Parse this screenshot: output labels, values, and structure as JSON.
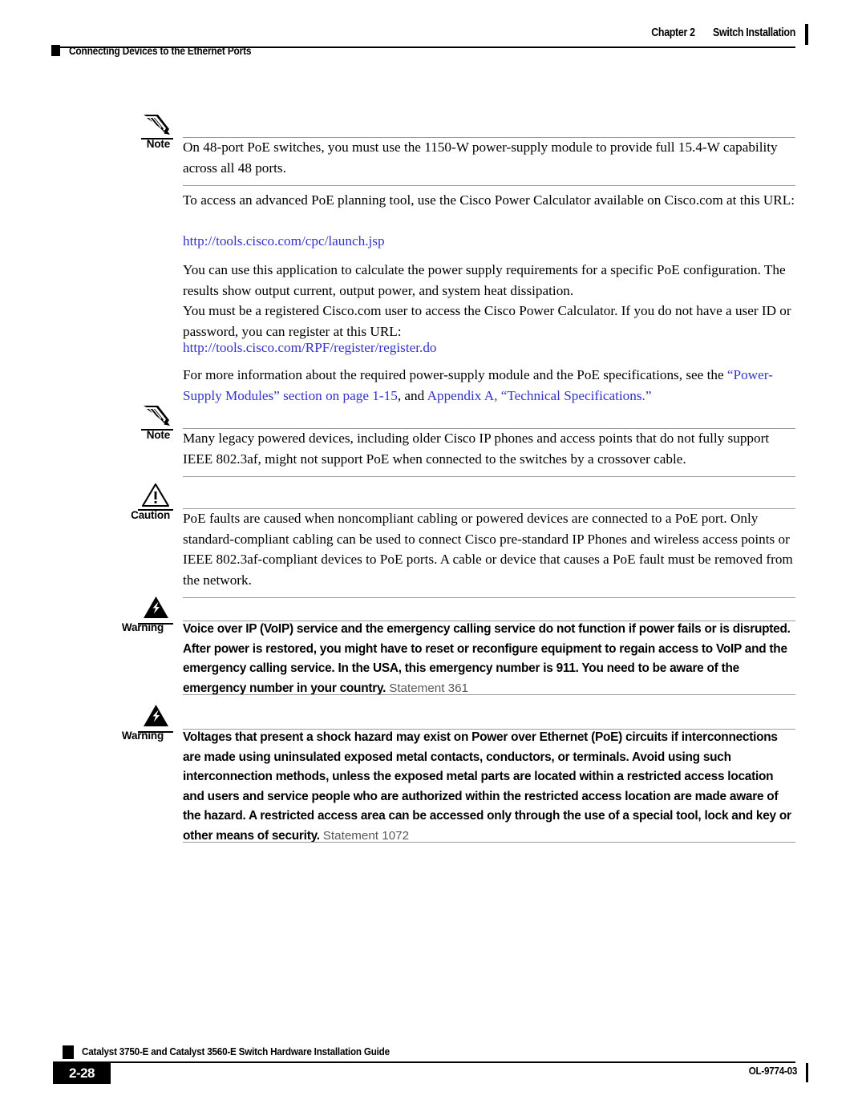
{
  "header": {
    "chapter_number": "Chapter 2",
    "chapter_title": "Switch Installation",
    "section_title": "Connecting Devices to the Ethernet Ports"
  },
  "content": {
    "note_1": {
      "label": "Note",
      "icon": "pencil-icon",
      "text": "On 48-port PoE switches, you must use the 1150-W power-supply module to provide full 15.4-W capability across all 48 ports."
    },
    "para_1": "To access an advanced PoE planning tool, use the Cisco Power Calculator available on Cisco.com at this URL:",
    "link_1": "http://tools.cisco.com/cpc/launch.jsp",
    "para_2": "You can use this application to calculate the power supply requirements for a specific PoE configuration. The results show output current, output power, and system heat dissipation.",
    "para_3": "You must be a registered Cisco.com user to access the Cisco Power Calculator. If you do not have a user ID or password, you can register at this URL:",
    "link_2": "http://tools.cisco.com/RPF/register/register.do",
    "para_4": "For more information about the required power-supply module and the PoE specifications, see the",
    "xref_1": "“Power-Supply Modules” section on page 1-15",
    "xref_sep": ", and ",
    "xref_2": "Appendix A, “Technical Specifications.”",
    "note_2": {
      "label": "Note",
      "icon": "pencil-icon",
      "text": "Many legacy powered devices, including older Cisco IP phones and access points that do not fully support IEEE 802.3af, might not support PoE when connected to the switches by a crossover cable."
    },
    "caution_1": {
      "label": "Caution",
      "icon": "caution-triangle-icon",
      "text": "PoE faults are caused when noncompliant cabling or powered devices are connected to a PoE port. Only standard-compliant cabling can be used to connect Cisco pre-standard IP Phones and wireless access points or IEEE 802.3af-compliant devices to PoE ports. A cable or device that causes a PoE fault must be removed from the network."
    },
    "warning_1": {
      "label": "Warning",
      "icon": "warning-lightning-icon",
      "text": "Voice over IP (VoIP) service and the emergency calling service do not function if power fails or is disrupted. After power is restored, you might have to reset or reconfigure equipment to regain access to VoIP and the emergency calling service. In the USA, this emergency number is 911. You need to be aware of the emergency number in your country.",
      "statement": "Statement 361"
    },
    "warning_2": {
      "label": "Warning",
      "icon": "warning-lightning-icon",
      "text": "Voltages that present a shock hazard may exist on Power over Ethernet (PoE) circuits if interconnections are made using uninsulated exposed metal contacts, conductors, or terminals. Avoid using such interconnection methods, unless the exposed metal parts are located within a restricted access location and users and service people who are authorized within the restricted access location are made aware of the hazard. A restricted access area can be accessed only through the use of a special tool, lock and key or other means of security.",
      "statement": "Statement 1072"
    }
  },
  "footer": {
    "page_number": "2-28",
    "document_title": "Catalyst 3750-E and Catalyst 3560-E Switch Hardware Installation Guide",
    "document_id": "OL-9774-03"
  },
  "colors": {
    "link": "#3333cc",
    "rule": "#9a9a9a",
    "statement_gray": "#55585b"
  }
}
